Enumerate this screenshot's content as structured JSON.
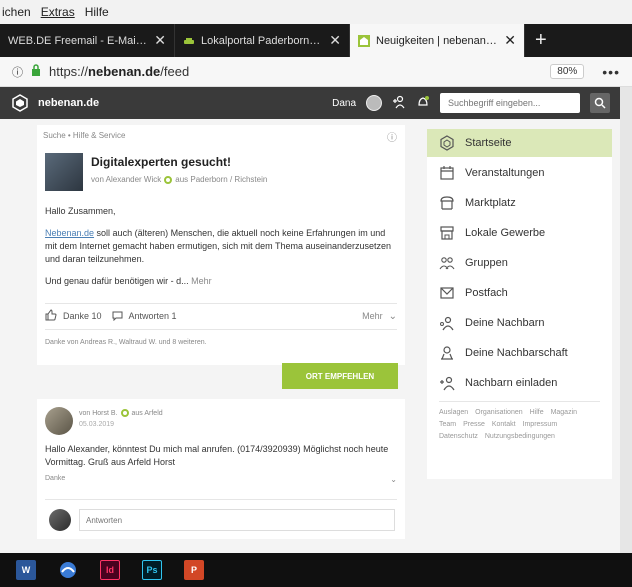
{
  "menubar": {
    "items": [
      "ichen",
      "Extras",
      "Hilfe"
    ]
  },
  "tabs": [
    {
      "title": "WEB.DE Freemail - E-Mail mad",
      "close": "✕",
      "active": false
    },
    {
      "title": "Lokalportal Paderborn - Deine",
      "close": "✕",
      "active": false
    },
    {
      "title": "Neuigkeiten | nebenan.de",
      "close": "✕",
      "active": true
    }
  ],
  "new_tab": "+",
  "address": {
    "scheme": "https://",
    "domain": "nebenan.de",
    "path": "/feed",
    "zoom": "80%",
    "more": "•••"
  },
  "header": {
    "logo_text": "nebenan.de",
    "user_name": "Dana",
    "search_placeholder": "Suchbegriff eingeben..."
  },
  "post": {
    "breadcrumb": "Suche • Hilfe & Service",
    "title": "Digitalexperten gesucht!",
    "author_prefix": "von Alexander Wick",
    "author_location": "aus Paderborn / Richstein",
    "greeting": "Hallo Zusammen,",
    "body_link": "Nebenan.de",
    "body_rest": " soll auch (älteren) Menschen, die aktuell noch keine Erfahrungen im und mit dem Internet gemacht haben ermutigen, sich mit dem Thema auseinanderzusetzen und daran teilzunehmen.",
    "body_teaser": "Und genau dafür benötigen wir - d...",
    "more_link": "Mehr",
    "thanks_label": "Danke 10",
    "answers_label": "Antworten 1",
    "more_label": "Mehr",
    "thanks_line": "Danke von Andreas R., Waltraud W. und 8 weiteren."
  },
  "recommend_button": "ORT EMPFEHLEN",
  "reply": {
    "author": "von Horst B.",
    "location": "aus Arfeld",
    "date": "05.03.2019",
    "body": "Hallo Alexander, könntest Du mich mal anrufen. (0174/3920939) Möglichst noch heute Vormittag. Gruß aus Arfeld Horst",
    "thanks": "Danke",
    "composer_placeholder": "Antworten"
  },
  "nav": {
    "items": [
      {
        "label": "Startseite",
        "icon": "home-icon",
        "active": true
      },
      {
        "label": "Veranstaltungen",
        "icon": "calendar-icon",
        "active": false
      },
      {
        "label": "Marktplatz",
        "icon": "market-icon",
        "active": false
      },
      {
        "label": "Lokale Gewerbe",
        "icon": "shop-icon",
        "active": false
      },
      {
        "label": "Gruppen",
        "icon": "groups-icon",
        "active": false
      },
      {
        "label": "Postfach",
        "icon": "mail-icon",
        "active": false
      },
      {
        "label": "Deine Nachbarn",
        "icon": "neighbors-icon",
        "active": false
      },
      {
        "label": "Deine Nachbarschaft",
        "icon": "map-pin-icon",
        "active": false
      },
      {
        "label": "Nachbarn einladen",
        "icon": "invite-icon",
        "active": false
      }
    ],
    "footer_links": [
      "Auslagen",
      "Organisationen",
      "Hilfe",
      "Magazin",
      "Team",
      "Presse",
      "Kontakt",
      "Impressum",
      "Datenschutz",
      "Nutzungsbedingungen"
    ]
  },
  "taskbar": {
    "apps": [
      {
        "name": "word-icon",
        "label": "W",
        "color": "#2b579a"
      },
      {
        "name": "browser-icon",
        "label": "",
        "color": "#3a7bd5"
      },
      {
        "name": "indesign-icon",
        "label": "Id",
        "color": "#49021f"
      },
      {
        "name": "photoshop-icon",
        "label": "Ps",
        "color": "#001d26"
      },
      {
        "name": "powerpoint-icon",
        "label": "P",
        "color": "#d24726"
      }
    ]
  },
  "colors": {
    "accent_green": "#9bc43a",
    "active_nav": "#dbe8b8",
    "header_dark": "#3a3a3a"
  }
}
